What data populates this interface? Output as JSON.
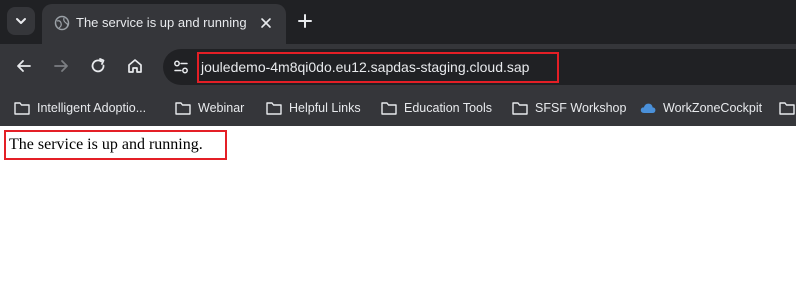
{
  "tab": {
    "title": "The service is up and running"
  },
  "address_bar": {
    "url": "jouledemo-4m8qi0do.eu12.sapdas-staging.cloud.sap"
  },
  "bookmarks": [
    {
      "label": "Intelligent Adoptio...",
      "icon": "folder-icon"
    },
    {
      "label": "Webinar",
      "icon": "folder-icon"
    },
    {
      "label": "Helpful Links",
      "icon": "folder-icon"
    },
    {
      "label": "Education Tools",
      "icon": "folder-icon"
    },
    {
      "label": "SFSF Workshop",
      "icon": "folder-icon"
    },
    {
      "label": "WorkZoneCockpit",
      "icon": "cloud-icon"
    }
  ],
  "page": {
    "text": "The service is up and running."
  },
  "colors": {
    "highlight": "#e41f26",
    "chrome_dark": "#202124",
    "chrome_toolbar": "#35363a",
    "text_light": "#e8eaed"
  }
}
